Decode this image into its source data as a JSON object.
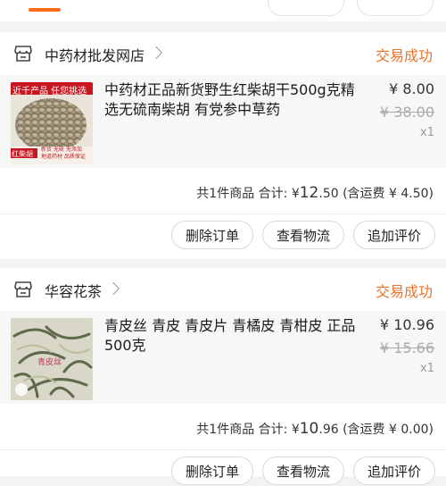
{
  "orders": [
    {
      "store_name": "中药材批发网店",
      "status": "交易成功",
      "item": {
        "title": "中药材正品新货野生红柴胡干500g克精选无硫南柴胡  有党参中草药",
        "price": "¥ 8.00",
        "original_price": "¥ 38.00",
        "quantity": "x1",
        "image_banner": "近千产品 任您挑选",
        "image_tag": "红柴胡",
        "image_caption": "新货  无硫  无添加\n地道药材  品质保证"
      },
      "summary": {
        "count_label": "共1件商品 合计:",
        "currency": "¥",
        "total_int": "12",
        "total_dec": ".50",
        "shipping": "(含运费 ¥ 4.50)"
      },
      "actions": [
        "删除订单",
        "查看物流",
        "追加评价"
      ]
    },
    {
      "store_name": "华容花茶",
      "status": "交易成功",
      "item": {
        "title": "青皮丝 青皮 青皮片 青橘皮 青柑皮 正品500克",
        "price": "¥ 10.96",
        "original_price": "¥ 15.66",
        "quantity": "x1",
        "image_tag": "青皮丝"
      },
      "summary": {
        "count_label": "共1件商品 合计:",
        "currency": "¥",
        "total_int": "10",
        "total_dec": ".96",
        "shipping": "(含运费 ¥ 0.00)"
      },
      "actions": [
        "删除订单",
        "查看物流",
        "追加评价"
      ]
    }
  ],
  "colors": {
    "accent": "#ff6a1a",
    "status": "#e8742c",
    "background": "#f3f3f3"
  }
}
